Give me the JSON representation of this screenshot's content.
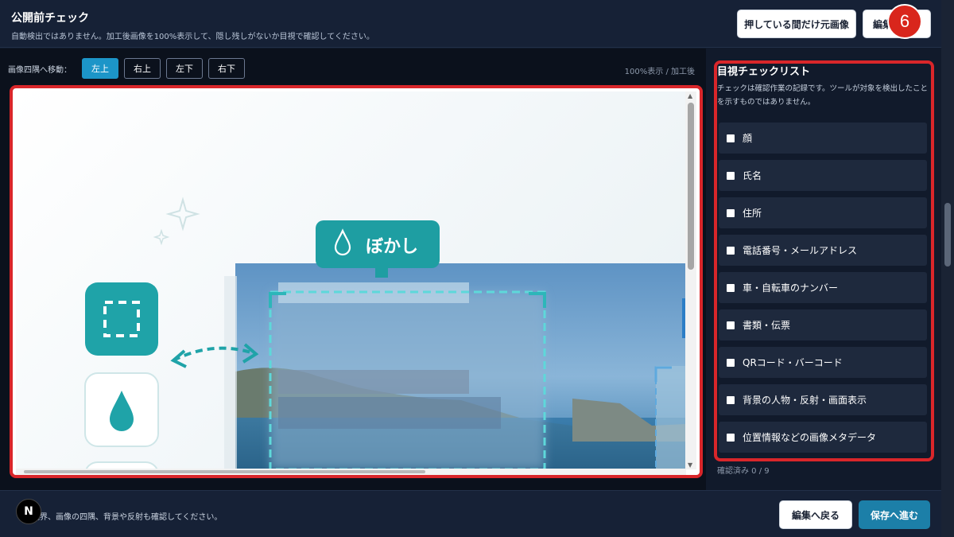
{
  "header": {
    "title": "公開前チェック",
    "subtitle": "自動検出ではありません。加工後画像を100%表示して、隠し残しがないか目視で確認してください。",
    "hold_original_label": "押している間だけ元画像",
    "edit_label": "編集",
    "step_badge": "6"
  },
  "preview": {
    "nav_label": "画像四隅へ移動：",
    "corners": [
      "左上",
      "右上",
      "左下",
      "右下"
    ],
    "active_corner": "左上",
    "zoom_label": "100%表示 / 加工後",
    "image": {
      "tag_label": "ぼかし"
    }
  },
  "checklist": {
    "title": "目視チェックリスト",
    "description": "チェックは確認作業の記録です。ツールが対象を検出したことを示すものではありません。",
    "items": [
      "顔",
      "氏名",
      "住所",
      "電話番号・メールアドレス",
      "車・自転車のナンバー",
      "書類・伝票",
      "QRコード・バーコード",
      "背景の人物・反射・画面表示",
      "位置情報などの画像メタデータ"
    ],
    "confirmed_count": "確認済み 0 / 9"
  },
  "footer": {
    "note": "境界、画像の四隅、背景や反射も確認してください。",
    "avatar_letter": "N",
    "back_label": "編集へ戻る",
    "save_label": "保存へ進む"
  },
  "colors": {
    "accent": "#1c7fa8",
    "active_tab": "#1c95c8",
    "highlight_border": "#d9262a",
    "teal_icon": "#1fa3a8",
    "background": "#111a2b"
  }
}
